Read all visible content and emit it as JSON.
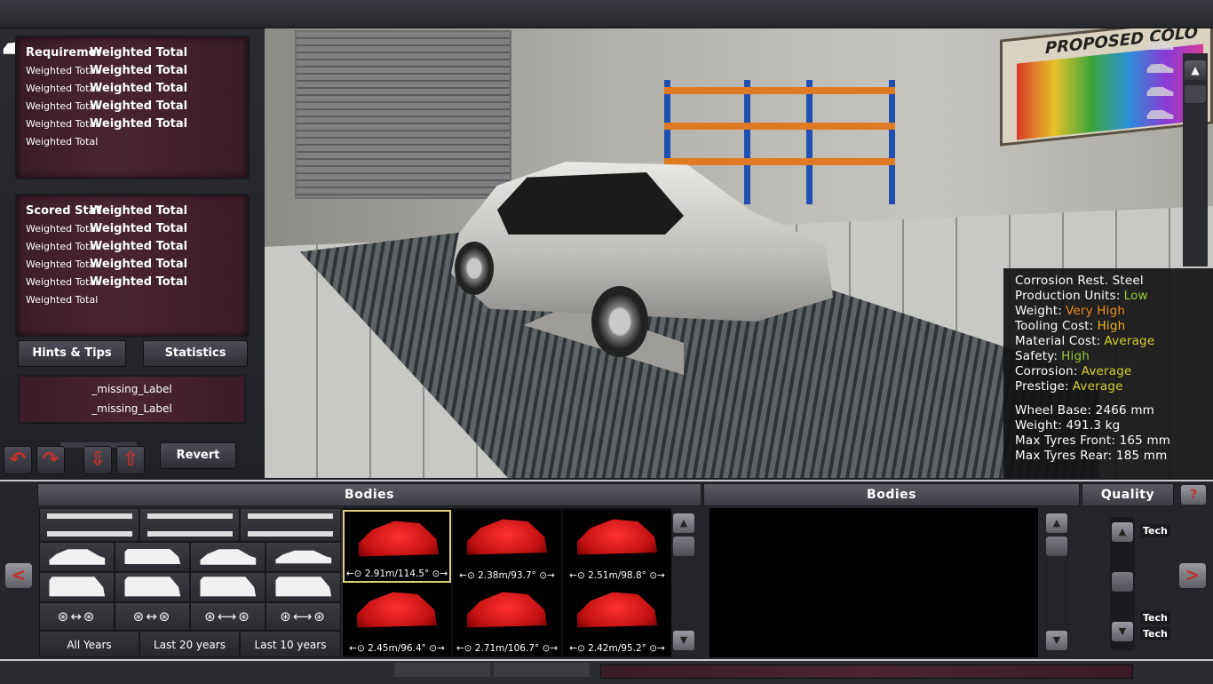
{
  "requirements": {
    "header": [
      "Requirements",
      "Weighted Total"
    ],
    "rows": [
      [
        "Weighted Total",
        "Weighted Total"
      ],
      [
        "Weighted Total",
        "Weighted Total"
      ],
      [
        "Weighted Total",
        "Weighted Total"
      ],
      [
        "Weighted Total",
        "Weighted Total"
      ],
      [
        "Weighted Total",
        ""
      ]
    ]
  },
  "scored_stats": {
    "header": [
      "Scored Stats",
      "Weighted Total"
    ],
    "rows": [
      [
        "Weighted Total",
        "Weighted Total"
      ],
      [
        "Weighted Total",
        "Weighted Total"
      ],
      [
        "Weighted Total",
        "Weighted Total"
      ],
      [
        "Weighted Total",
        "Weighted Total"
      ],
      [
        "Weighted Total",
        ""
      ]
    ]
  },
  "buttons": {
    "hints": "Hints & Tips",
    "statistics": "Statistics",
    "revert": "Revert"
  },
  "missing_labels": [
    "_missing_Label",
    "_missing_Label"
  ],
  "viewport": {
    "poster_title": "PROPOSED COLO"
  },
  "info": {
    "lines": [
      {
        "label": "Corrosion Rest. Steel",
        "value": "",
        "color": "#ffffff"
      },
      {
        "label": "Production Units:",
        "value": "Low",
        "color": "#9acd32"
      },
      {
        "label": "Weight:",
        "value": "Very High",
        "color": "#f08a1c"
      },
      {
        "label": "Tooling Cost:",
        "value": "High",
        "color": "#f0b020"
      },
      {
        "label": "Material Cost:",
        "value": "Average",
        "color": "#d4d02a"
      },
      {
        "label": "Safety:",
        "value": "High",
        "color": "#9acd32"
      },
      {
        "label": "Corrosion:",
        "value": "Average",
        "color": "#d4d02a"
      },
      {
        "label": "Prestige:",
        "value": "Average",
        "color": "#d4d02a"
      }
    ],
    "specs": [
      "Wheel Base: 2466 mm",
      "Weight: 491.3 kg",
      "Max Tyres Front: 165 mm",
      "Max Tyres Rear: 185 mm"
    ]
  },
  "bottom": {
    "header_bodies_left": "Bodies",
    "header_bodies_right": "Bodies",
    "header_quality": "Quality",
    "help": "?",
    "year_filters": [
      "All Years",
      "Last 20 years",
      "Last 10 years"
    ],
    "body_tiles": [
      {
        "label": "←⊙ 2.91m/114.5° ⊙→",
        "selected": true
      },
      {
        "label": "←⊙ 2.38m/93.7° ⊙→",
        "selected": false
      },
      {
        "label": "←⊙ 2.51m/98.8° ⊙→",
        "selected": false
      },
      {
        "label": "←⊙ 2.45m/96.4° ⊙→",
        "selected": false
      },
      {
        "label": "←⊙ 2.71m/106.7° ⊙→",
        "selected": false
      },
      {
        "label": "←⊙ 2.42m/95.2° ⊙→",
        "selected": false
      }
    ],
    "quality_labels": [
      "Tech",
      "Tech",
      "Tech"
    ],
    "category_icons": [
      "chassis-front-engine-icon",
      "chassis-mid-engine-icon",
      "chassis-rear-engine-icon",
      "sedan-icon",
      "wagon-icon",
      "hatchback-icon",
      "coupe-icon",
      "suv-icon",
      "pickup-icon",
      "van-icon",
      "panel-van-icon",
      "wheelbase-short-icon",
      "wheelbase-medium-icon",
      "wheelbase-long-icon",
      "wheelbase-xlong-icon"
    ]
  },
  "colors": {
    "accent_red": "#c53030",
    "panel_maroon": "#4a2431",
    "selection_gold": "#e0d27a"
  }
}
